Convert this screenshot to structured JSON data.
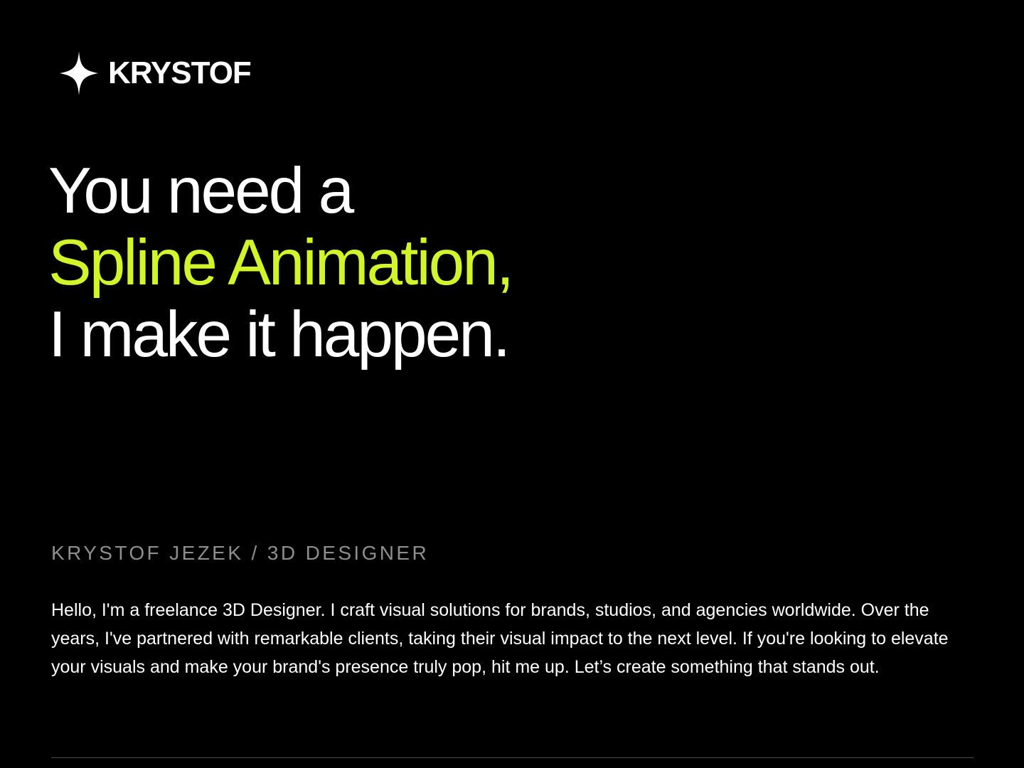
{
  "brand": {
    "name": "KRYSTOF",
    "icon": "four-point-star-icon"
  },
  "hero": {
    "line1": "You need a",
    "line2": "Spline Animation,",
    "line3": "I make it happen."
  },
  "subtitle": "KRYSTOF JEZEK / 3D DESIGNER",
  "bio": "Hello, I'm a freelance 3D Designer. I craft visual solutions for brands, studios, and agencies worldwide. Over the years, I've partnered with remarkable clients, taking their visual impact to the next level. If you're looking to elevate your visuals and make your brand's presence truly pop, hit me up. Let’s create something that stands out.",
  "colors": {
    "background": "#000000",
    "text": "#ffffff",
    "accent": "#d2f52a",
    "muted": "#8e8e8e",
    "divider": "#4a4a4a"
  }
}
